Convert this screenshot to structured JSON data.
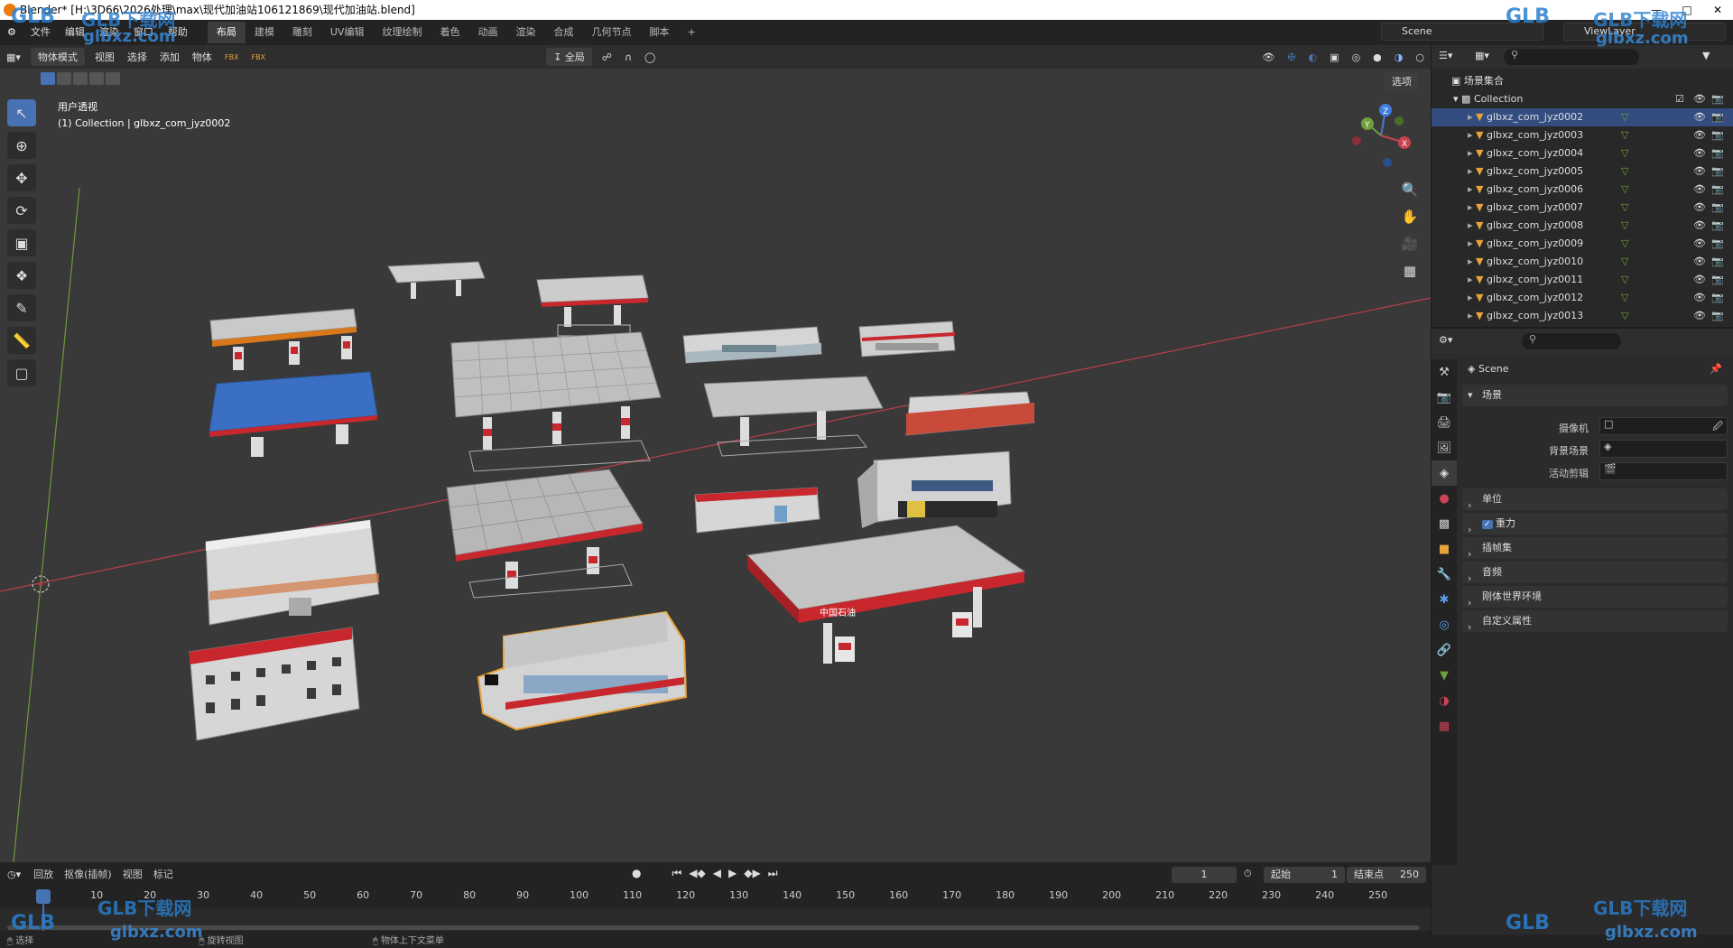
{
  "title_bar": {
    "text": "Blender* [H:\\3D66\\2026处理\\max\\现代加油站106121869\\现代加油站.blend]"
  },
  "menu": {
    "items": [
      "文件",
      "编辑",
      "渲染",
      "窗口",
      "帮助"
    ]
  },
  "workspaces": [
    "布局",
    "建模",
    "雕刻",
    "UV编辑",
    "纹理绘制",
    "着色",
    "动画",
    "渲染",
    "合成",
    "几何节点",
    "脚本"
  ],
  "active_workspace": "布局",
  "scene_field": "Scene",
  "viewlayer_field": "ViewLayer",
  "viewport_header": {
    "mode": "物体模式",
    "menus": [
      "视图",
      "选择",
      "添加",
      "物体"
    ],
    "transform_orientation": "全局",
    "options": "选项"
  },
  "viewport_info": {
    "view_name": "用户透视",
    "collection_line": "(1) Collection | glbxz_com_jyz0002"
  },
  "outliner": {
    "root": "场景集合",
    "collection": "Collection",
    "items": [
      "glbxz_com_jyz0002",
      "glbxz_com_jyz0003",
      "glbxz_com_jyz0004",
      "glbxz_com_jyz0005",
      "glbxz_com_jyz0006",
      "glbxz_com_jyz0007",
      "glbxz_com_jyz0008",
      "glbxz_com_jyz0009",
      "glbxz_com_jyz0010",
      "glbxz_com_jyz0011",
      "glbxz_com_jyz0012",
      "glbxz_com_jyz0013"
    ],
    "selected": "glbxz_com_jyz0002"
  },
  "properties": {
    "context_name": "Scene",
    "scene_panel": "场景",
    "fields": [
      {
        "label": "摄像机"
      },
      {
        "label": "背景场景"
      },
      {
        "label": "活动剪辑"
      }
    ],
    "panels": [
      "单位",
      "重力",
      "插帧集",
      "音频",
      "刚体世界环境",
      "自定义属性"
    ],
    "gravity_checked": true
  },
  "timeline": {
    "menus": [
      "回放",
      "抠像(插帧)",
      "视图",
      "标记"
    ],
    "current_frame": "1",
    "start_label": "起始",
    "start_value": "1",
    "end_label": "结束点",
    "end_value": "250",
    "ruler_ticks": [
      "1",
      "10",
      "20",
      "30",
      "40",
      "50",
      "60",
      "70",
      "80",
      "90",
      "100",
      "110",
      "120",
      "130",
      "140",
      "150",
      "160",
      "170",
      "180",
      "190",
      "200",
      "210",
      "220",
      "230",
      "240",
      "250"
    ]
  },
  "status_bar": {
    "items": [
      "选择",
      "旋转视图",
      "物体上下文菜单"
    ]
  },
  "watermarks": {
    "brand": "GLB下载网",
    "url": "glbxz.com",
    "logo": "GLB"
  },
  "colors": {
    "accent": "#4772b3",
    "selection_outline": "#e8a33a",
    "red_canopy": "#c8282d",
    "blue_roof": "#3b6fc4",
    "axis_x": "#c8424f",
    "axis_y": "#6ea03c",
    "axis_z": "#3f7de0"
  }
}
